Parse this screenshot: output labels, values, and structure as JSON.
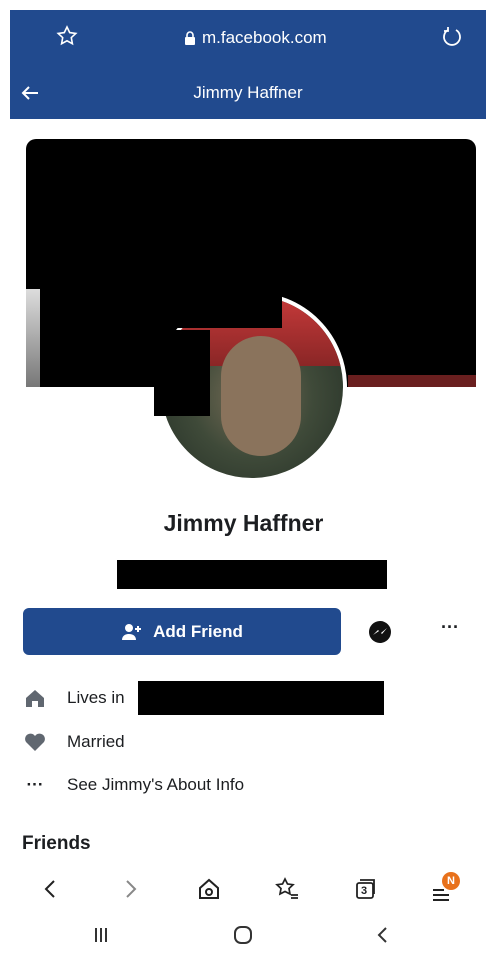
{
  "browser": {
    "url": "m.facebook.com",
    "icons": {
      "bookmark": "star-icon",
      "secure": "lock-icon",
      "reload": "reload-icon"
    }
  },
  "header": {
    "title": "Jimmy Haffner",
    "back_icon": "back-arrow-icon"
  },
  "profile": {
    "name": "Jimmy Haffner",
    "add_friend_label": "Add Friend",
    "more_label": "···"
  },
  "info": {
    "lives_in_label": "Lives in",
    "married_label": "Married",
    "about_label": "See Jimmy's About Info",
    "about_icon_glyph": "···"
  },
  "friends": {
    "label": "Friends"
  },
  "browser_nav": {
    "tab_count": "3",
    "menu_badge": "N"
  },
  "colors": {
    "brand": "#214a8e",
    "text": "#1c1e21",
    "badge": "#e8711b"
  }
}
